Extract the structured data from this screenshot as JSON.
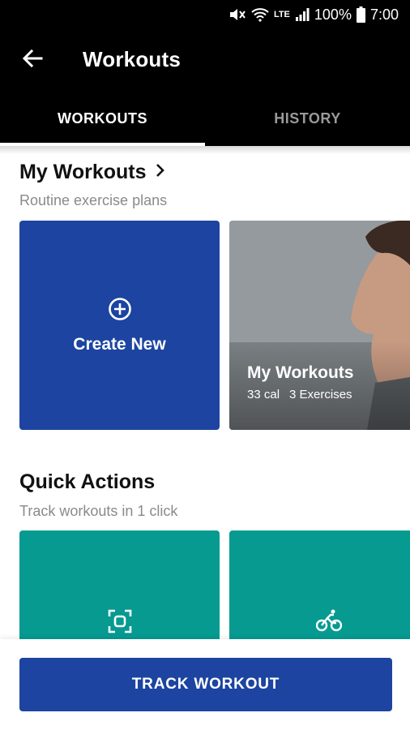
{
  "status_bar": {
    "battery": "100%",
    "time": "7:00",
    "network": "LTE"
  },
  "app_bar": {
    "title": "Workouts",
    "back_icon": "arrow-left-icon"
  },
  "tabs": [
    {
      "label": "WORKOUTS",
      "active": true
    },
    {
      "label": "HISTORY",
      "active": false
    }
  ],
  "my_workouts": {
    "title": "My Workouts",
    "subtitle": "Routine exercise plans",
    "create_card": {
      "label": "Create New",
      "icon": "plus-circle-icon",
      "color": "#1c44a0"
    },
    "workout_card": {
      "title": "My Workouts",
      "calories": "33 cal",
      "exercises": "3 Exercises"
    }
  },
  "quick_actions": {
    "title": "Quick Actions",
    "subtitle": "Track workouts in 1 click",
    "cards": [
      {
        "icon": "scan-icon",
        "color": "#069a91"
      },
      {
        "icon": "bicycle-icon",
        "color": "#069a91"
      }
    ]
  },
  "bottom": {
    "track_label": "TRACK WORKOUT"
  }
}
